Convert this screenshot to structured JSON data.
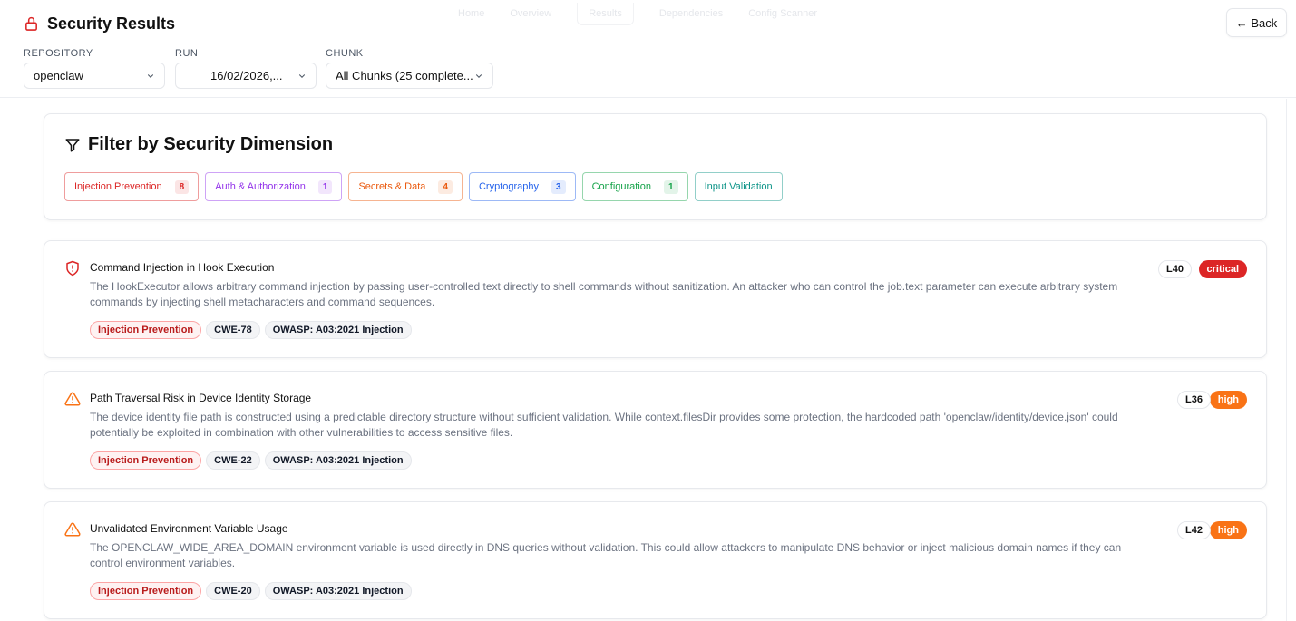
{
  "header": {
    "title": "Security Results",
    "ghost_tabs": [
      "Home",
      "Overview",
      "Results",
      "Dependencies",
      "Config Scanner"
    ],
    "back_label": "← Back"
  },
  "filters": {
    "repository": {
      "label": "REPOSITORY",
      "value": "openclaw"
    },
    "run": {
      "label": "RUN",
      "value": "16/02/2026,..."
    },
    "chunk": {
      "label": "CHUNK",
      "value": "All Chunks (25 complete..."
    }
  },
  "dimension_filter": {
    "title": "Filter by Security Dimension",
    "chips": [
      {
        "label": "Injection Prevention",
        "count": "8",
        "color": "#dc2626"
      },
      {
        "label": "Auth & Authorization",
        "count": "1",
        "color": "#9333ea"
      },
      {
        "label": "Secrets & Data",
        "count": "4",
        "color": "#ea580c"
      },
      {
        "label": "Cryptography",
        "count": "3",
        "color": "#2563eb"
      },
      {
        "label": "Configuration",
        "count": "1",
        "color": "#16a34a"
      },
      {
        "label": "Input Validation",
        "count": "",
        "color": "#0d9488"
      }
    ]
  },
  "issues": [
    {
      "title": "Command Injection in Hook Execution",
      "description": "The HookExecutor allows arbitrary command injection by passing user-controlled text directly to shell commands without sanitization. An attacker who can control the job.text parameter can execute arbitrary system commands by injecting shell metacharacters and command sequences.",
      "tags": [
        "Injection Prevention",
        "CWE-78",
        "OWASP: A03:2021 Injection"
      ],
      "line": "L40",
      "severity": "critical",
      "severity_color": "#dc2626",
      "icon": "shield-alert-icon"
    },
    {
      "title": "Path Traversal Risk in Device Identity Storage",
      "description": "The device identity file path is constructed using a predictable directory structure without sufficient validation. While context.filesDir provides some protection, the hardcoded path 'openclaw/identity/device.json' could potentially be exploited in combination with other vulnerabilities to access sensitive files.",
      "tags": [
        "Injection Prevention",
        "CWE-22",
        "OWASP: A03:2021 Injection"
      ],
      "line": "L36",
      "severity": "high",
      "severity_color": "#f97316",
      "icon": "warning-triangle-icon"
    },
    {
      "title": "Unvalidated Environment Variable Usage",
      "description": "The OPENCLAW_WIDE_AREA_DOMAIN environment variable is used directly in DNS queries without validation. This could allow attackers to manipulate DNS behavior or inject malicious domain names if they can control environment variables.",
      "tags": [
        "Injection Prevention",
        "CWE-20",
        "OWASP: A03:2021 Injection"
      ],
      "line": "L42",
      "severity": "high",
      "severity_color": "#f97316",
      "icon": "warning-triangle-icon"
    }
  ]
}
